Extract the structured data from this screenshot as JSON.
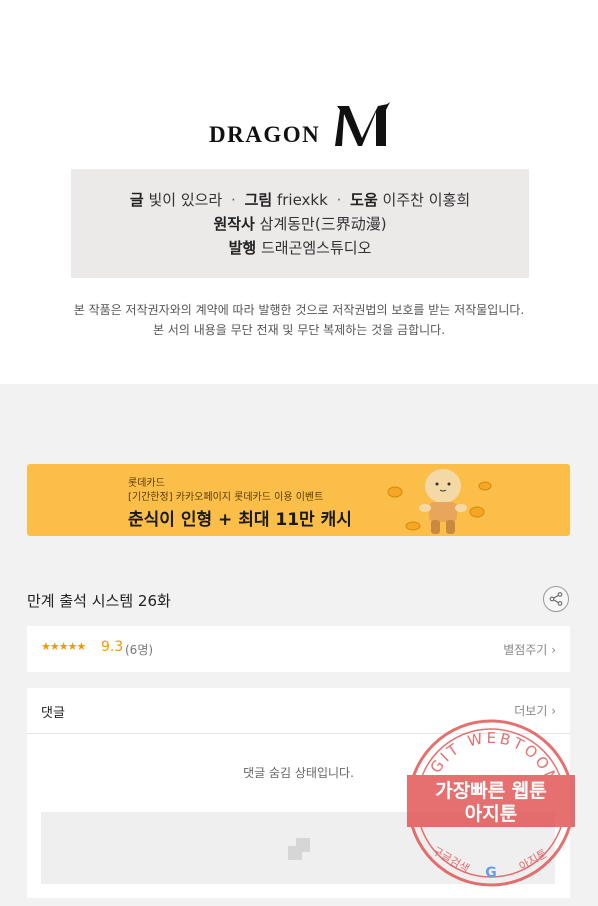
{
  "publisher": {
    "logo_word": "DRAGON",
    "logo_mark": "M"
  },
  "credits": {
    "writer_label": "글",
    "writer_value": "빛이 있으라",
    "artist_label": "그림",
    "artist_value": "friexkk",
    "assist_label": "도움",
    "assist_value": "이주찬 이홍희",
    "original_label": "원작사",
    "original_value": "삼계동만(三界动漫)",
    "publish_label": "발행",
    "publish_value": "드래곤엠스튜디오",
    "separator": "·"
  },
  "notice": {
    "line1": "본 작품은 저작권자와의 계약에 따라 발행한 것으로 저작권법의 보호를 받는 저작물입니다.",
    "line2": "본 서의 내용을 무단 전재 및 무단 복제하는 것을 금합니다."
  },
  "banner": {
    "brand": "롯데카드",
    "subtitle": "[기간한정] 카카오페이지 롯데카드 이용 이벤트",
    "headline": "춘식이 인형 + 최대 11만 캐시"
  },
  "episode": {
    "title": "만계 출석 시스템 26화"
  },
  "rating": {
    "stars": "★★★★★",
    "score": "9.3",
    "count": "(6명)",
    "rate_button": "별점주기",
    "rate_chevron": "›"
  },
  "comments": {
    "label": "댓글",
    "more": "더보기",
    "more_chevron": "›",
    "hidden_message": "댓글 숨김 상태입니다."
  },
  "watermark": {
    "arc_text": "AGIT WEBTOON",
    "line1": "가장빠른 웹툰",
    "line2": "아지툰",
    "bottom_left": "구글검색",
    "bottom_right": "아지툰",
    "bottom_mark": "G"
  },
  "colors": {
    "banner_bg": "#fbbf49",
    "rating_accent": "#f29900",
    "credits_bg": "#ece9e9",
    "page_bg": "#f2f2f2",
    "stamp_red": "#e04848"
  }
}
